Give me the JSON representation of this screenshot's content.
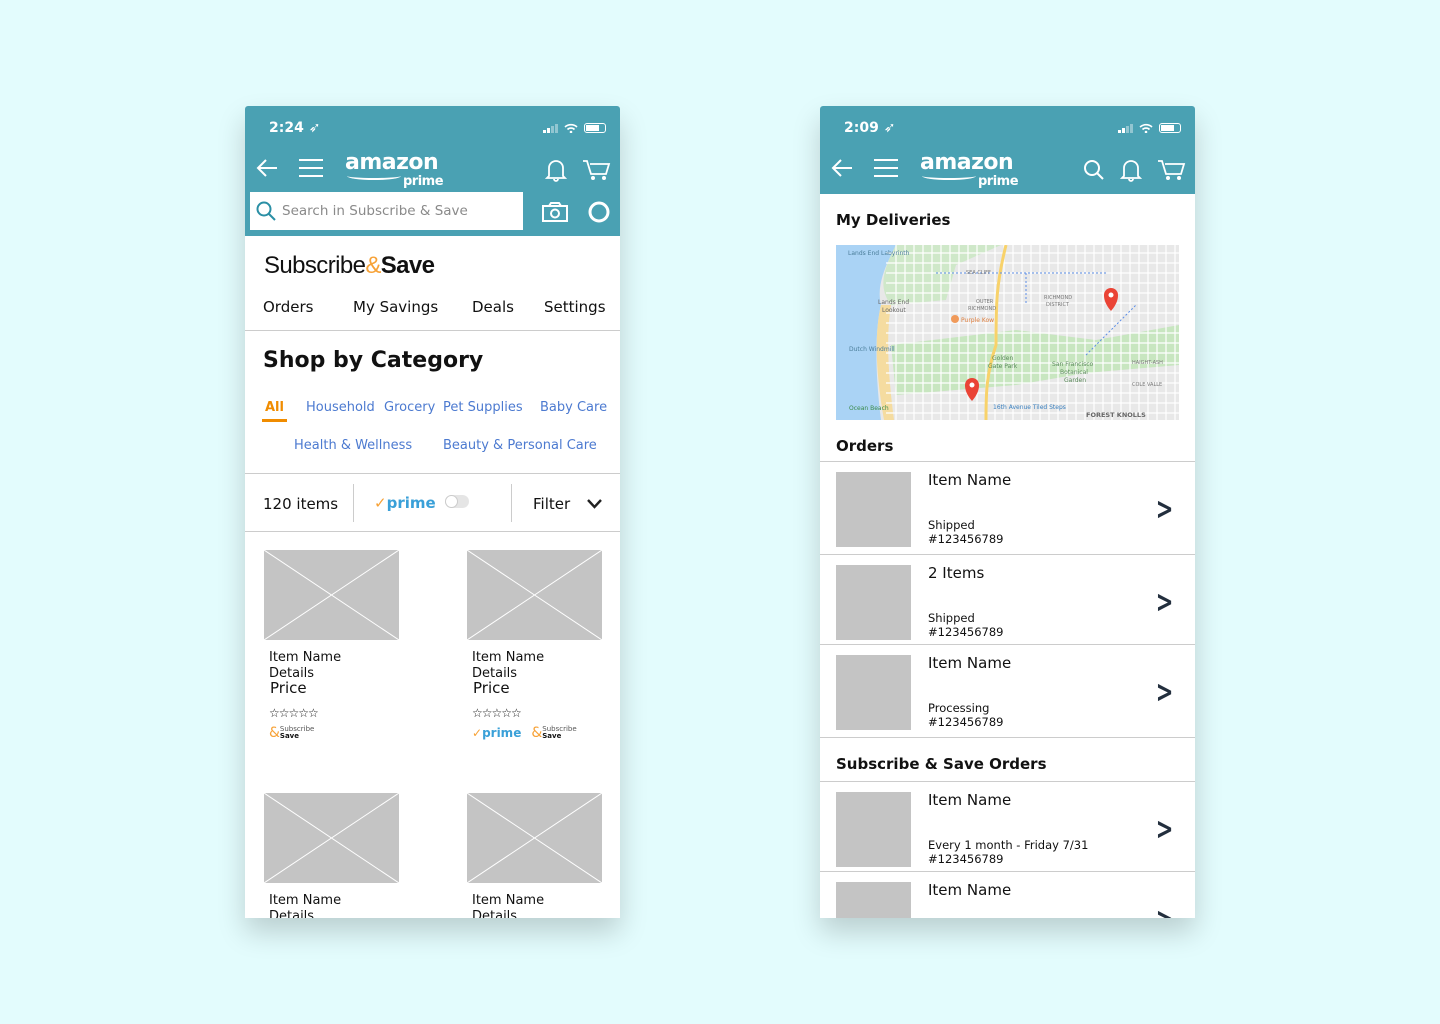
{
  "colors": {
    "header": "#4aa1b3",
    "accent_orange": "#f08c00",
    "link_blue": "#4c7ad0",
    "background": "#e3fcfd",
    "pin_red": "#ea4335"
  },
  "left": {
    "status": {
      "time": "2:24"
    },
    "logo": {
      "word": "amazon",
      "sub": "prime"
    },
    "search": {
      "placeholder": "Search in Subscribe & Save"
    },
    "brand": {
      "part1": "Subscribe",
      "amp": "&",
      "part2": "Save"
    },
    "tabs": [
      "Orders",
      "My Savings",
      "Deals",
      "Settings"
    ],
    "section_title": "Shop by Category",
    "categories": [
      "All",
      "Household",
      "Grocery",
      "Pet Supplies",
      "Baby Care",
      "Health & Wellness",
      "Beauty & Personal Care"
    ],
    "active_category": "All",
    "filter_bar": {
      "count": "120 items",
      "prime_check": "✓",
      "prime": "prime",
      "prime_toggle_on": false,
      "filter": "Filter"
    },
    "products": [
      {
        "name": "Item Name",
        "details": "Details",
        "price": "Price",
        "rating": 0,
        "prime": false,
        "badge_sub": "Subscribe",
        "badge_save": "Save"
      },
      {
        "name": "Item Name",
        "details": "Details",
        "price": "Price",
        "rating": 0,
        "prime": true,
        "badge_sub": "Subscribe",
        "badge_save": "Save"
      },
      {
        "name": "Item Name",
        "details": "Details",
        "price": "",
        "rating": 0,
        "prime": false,
        "badge_sub": "",
        "badge_save": ""
      },
      {
        "name": "Item Name",
        "details": "Details",
        "price": "",
        "rating": 0,
        "prime": false,
        "badge_sub": "",
        "badge_save": ""
      }
    ]
  },
  "right": {
    "status": {
      "time": "2:09"
    },
    "logo": {
      "word": "amazon",
      "sub": "prime"
    },
    "deliveries_title": "My Deliveries",
    "map_labels": {
      "a": "Lands End Labyrinth",
      "b": "SEA CLIFF",
      "c": "Lands End",
      "c2": "Lookout",
      "d": "OUTER",
      "d2": "RICHMOND",
      "e": "RICHMOND",
      "e2": "DISTRICT",
      "f": "Purple Kow",
      "g": "Dutch Windmill",
      "h": "Golden",
      "h2": "Gate Park",
      "i": "San Francisco",
      "i2": "Botanical",
      "i3": "Garden",
      "j": "HAIGHT-ASH",
      "k": "COLE VALLE",
      "l": "Ocean Beach",
      "m": "16th Avenue Tiled Steps",
      "n": "FOREST KNOLLS"
    },
    "orders_title": "Orders",
    "orders": [
      {
        "name": "Item Name",
        "status": "Shipped",
        "number": "#123456789"
      },
      {
        "name": "2 Items",
        "status": "Shipped",
        "number": "#123456789"
      },
      {
        "name": "Item Name",
        "status": "Processing",
        "number": "#123456789"
      }
    ],
    "sns_title": "Subscribe & Save Orders",
    "sns_orders": [
      {
        "name": "Item Name",
        "status": "Every 1 month - Friday 7/31",
        "number": "#123456789"
      },
      {
        "name": "Item Name",
        "status": "",
        "number": ""
      }
    ]
  }
}
